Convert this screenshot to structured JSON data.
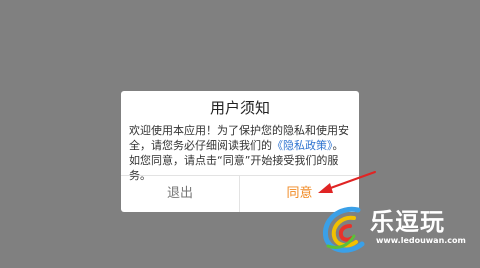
{
  "dialog": {
    "title": "用户须知",
    "body_part1": "欢迎使用本应用！为了保护您的隐私和使用安全，请您务必仔细阅读我们的",
    "policy_link": "《隐私政策》",
    "body_part2": "。如您同意，请点击“同意”开始接受我们的服务。",
    "exit_label": "退出",
    "agree_label": "同意"
  },
  "watermark": {
    "name": "乐逗玩",
    "url": "www.ledouwan.com"
  },
  "colors": {
    "overlay": "#808080",
    "agree": "#f08a24",
    "link": "#2f74d0",
    "arrow": "#e02424"
  }
}
